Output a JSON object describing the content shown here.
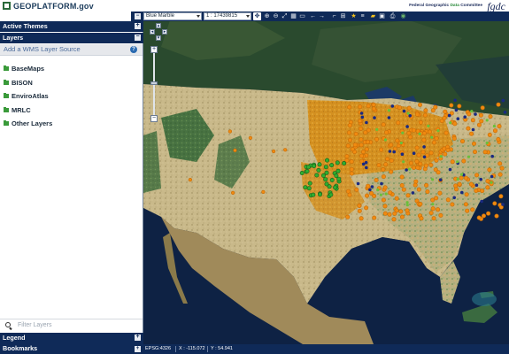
{
  "header": {
    "logo_text": "GEOPLATFORM.gov",
    "tagline_pre": "Federal Geographic ",
    "tagline_data": "Data",
    "tagline_post": " Committee",
    "fgdc_logo": "fgdc"
  },
  "sidebar": {
    "active_themes_label": "Active Themes",
    "layers_label": "Layers",
    "add_wms_label": "Add a WMS Layer Source",
    "help_glyph": "?",
    "layer_items": [
      {
        "label": "BaseMaps"
      },
      {
        "label": "BISON"
      },
      {
        "label": "EnviroAtlas"
      },
      {
        "label": "MRLC"
      },
      {
        "label": "Other Layers"
      }
    ],
    "filter_placeholder": "Filter Layers",
    "legend_label": "Legend",
    "bookmarks_label": "Bookmarks"
  },
  "toolbar": {
    "basemap_value": "Blue Marble",
    "scale_value": "1 : 17439815"
  },
  "statusbar": {
    "epsg": "EPSG:4326",
    "x": "X : -115.072",
    "y": "Y : 54.941"
  },
  "colors": {
    "navy_bar": "#0f2a58",
    "ocean": "#0e2244",
    "land_dry": "#c9b98a",
    "cropland": "#e69a1c",
    "forest": "#2f6a3a",
    "point_orange": "#f08a10",
    "point_green": "#2fae2f",
    "point_navy": "#1a2a80"
  }
}
